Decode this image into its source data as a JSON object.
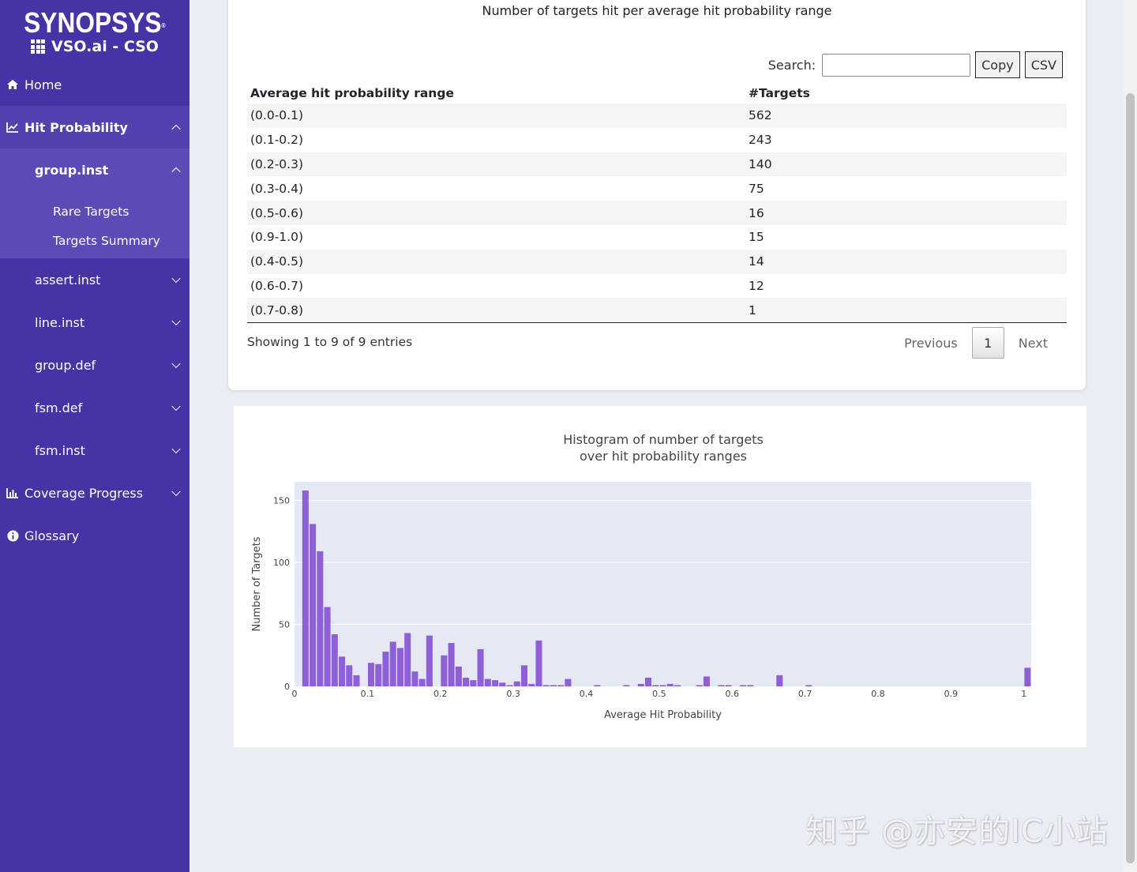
{
  "brand": {
    "logo": "SYNOPSYS",
    "product": "VSO.ai - CSO"
  },
  "nav": {
    "home": "Home",
    "hit_probability": "Hit Probability",
    "group_inst": "group.inst",
    "rare_targets": "Rare Targets",
    "targets_summary": "Targets Summary",
    "assert_inst": "assert.inst",
    "line_inst": "line.inst",
    "group_def": "group.def",
    "fsm_def": "fsm.def",
    "fsm_inst": "fsm.inst",
    "coverage_progress": "Coverage Progress",
    "glossary": "Glossary"
  },
  "table_card": {
    "title": "Number of targets hit per average hit probability range",
    "search_label": "Search:",
    "search_value": "",
    "copy_label": "Copy",
    "csv_label": "CSV",
    "columns": [
      "Average hit probability range",
      "#Targets"
    ],
    "rows": [
      [
        "(0.0-0.1)",
        "562"
      ],
      [
        "(0.1-0.2)",
        "243"
      ],
      [
        "(0.2-0.3)",
        "140"
      ],
      [
        "(0.3-0.4)",
        "75"
      ],
      [
        "(0.5-0.6)",
        "16"
      ],
      [
        "(0.9-1.0)",
        "15"
      ],
      [
        "(0.4-0.5)",
        "14"
      ],
      [
        "(0.6-0.7)",
        "12"
      ],
      [
        "(0.7-0.8)",
        "1"
      ]
    ],
    "info": "Showing 1 to 9 of 9 entries",
    "prev_label": "Previous",
    "current_page": "1",
    "next_label": "Next"
  },
  "chart_data": {
    "type": "bar",
    "title": "Histogram of number of targets over hit probability ranges",
    "title_lines": [
      "Histogram of number of targets",
      "over hit probability ranges"
    ],
    "xlabel": "Average Hit Probability",
    "ylabel": "Number of Targets",
    "xlim": [
      0,
      1.01
    ],
    "ylim": [
      0,
      165
    ],
    "bin_width": 0.01,
    "x_ticks": [
      "0",
      "0.1",
      "0.2",
      "0.3",
      "0.4",
      "0.5",
      "0.6",
      "0.7",
      "0.8",
      "0.9",
      "1"
    ],
    "y_ticks": [
      "0",
      "50",
      "100",
      "150"
    ],
    "grid": true,
    "bar_color": "#8e5fd6",
    "plot_bg": "#e5e9f4",
    "bins": [
      {
        "x": 0.01,
        "y": 158
      },
      {
        "x": 0.02,
        "y": 131
      },
      {
        "x": 0.03,
        "y": 109
      },
      {
        "x": 0.04,
        "y": 64
      },
      {
        "x": 0.05,
        "y": 42
      },
      {
        "x": 0.06,
        "y": 24
      },
      {
        "x": 0.07,
        "y": 17
      },
      {
        "x": 0.08,
        "y": 9
      },
      {
        "x": 0.1,
        "y": 19
      },
      {
        "x": 0.11,
        "y": 18
      },
      {
        "x": 0.12,
        "y": 28
      },
      {
        "x": 0.13,
        "y": 36
      },
      {
        "x": 0.14,
        "y": 31
      },
      {
        "x": 0.15,
        "y": 43
      },
      {
        "x": 0.16,
        "y": 12
      },
      {
        "x": 0.17,
        "y": 6
      },
      {
        "x": 0.18,
        "y": 41
      },
      {
        "x": 0.2,
        "y": 25
      },
      {
        "x": 0.21,
        "y": 35
      },
      {
        "x": 0.22,
        "y": 16
      },
      {
        "x": 0.23,
        "y": 7
      },
      {
        "x": 0.24,
        "y": 5
      },
      {
        "x": 0.25,
        "y": 30
      },
      {
        "x": 0.26,
        "y": 6
      },
      {
        "x": 0.27,
        "y": 5
      },
      {
        "x": 0.28,
        "y": 3
      },
      {
        "x": 0.29,
        "y": 1
      },
      {
        "x": 0.3,
        "y": 4
      },
      {
        "x": 0.31,
        "y": 17
      },
      {
        "x": 0.32,
        "y": 2
      },
      {
        "x": 0.33,
        "y": 37
      },
      {
        "x": 0.34,
        "y": 1
      },
      {
        "x": 0.35,
        "y": 1
      },
      {
        "x": 0.36,
        "y": 1
      },
      {
        "x": 0.37,
        "y": 6
      },
      {
        "x": 0.41,
        "y": 1
      },
      {
        "x": 0.45,
        "y": 1
      },
      {
        "x": 0.47,
        "y": 2
      },
      {
        "x": 0.48,
        "y": 7
      },
      {
        "x": 0.49,
        "y": 1
      },
      {
        "x": 0.5,
        "y": 1
      },
      {
        "x": 0.51,
        "y": 2
      },
      {
        "x": 0.52,
        "y": 1
      },
      {
        "x": 0.55,
        "y": 1
      },
      {
        "x": 0.56,
        "y": 8
      },
      {
        "x": 0.58,
        "y": 1
      },
      {
        "x": 0.59,
        "y": 1
      },
      {
        "x": 0.61,
        "y": 1
      },
      {
        "x": 0.62,
        "y": 1
      },
      {
        "x": 0.66,
        "y": 9
      },
      {
        "x": 0.7,
        "y": 1
      },
      {
        "x": 1.0,
        "y": 15
      }
    ]
  },
  "watermark": "知乎 @亦安的IC小站"
}
